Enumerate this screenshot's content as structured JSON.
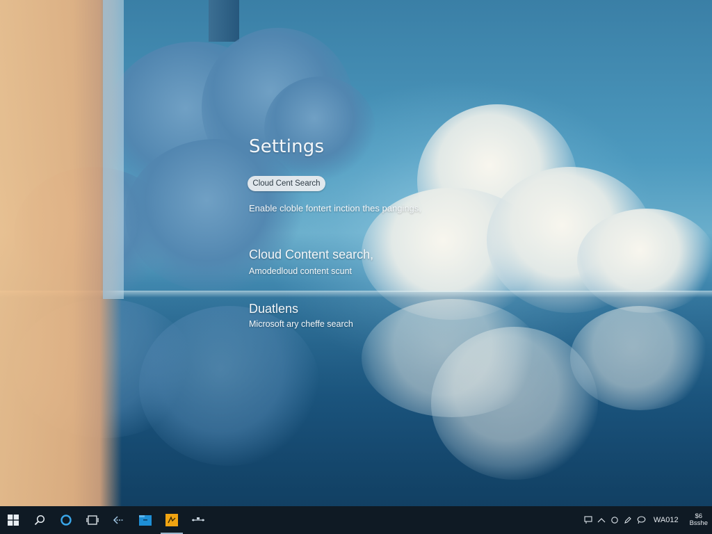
{
  "settings": {
    "title": "Settings",
    "pill_button_label": "Cloud Cent Search",
    "description": "Enable cloble fontert inction thes pangings,",
    "sections": [
      {
        "title": "Cloud Content search,",
        "subtitle": "Amodedloud content scunt"
      },
      {
        "title": "Duatlens",
        "subtitle": "Microsoft ary cheffe search"
      }
    ]
  },
  "taskbar": {
    "apps": [
      {
        "name": "start",
        "icon": "windows-logo-icon"
      },
      {
        "name": "search",
        "icon": "search-icon"
      },
      {
        "name": "cortana",
        "icon": "cortana-ring-icon"
      },
      {
        "name": "task-view",
        "icon": "task-view-icon"
      },
      {
        "name": "back",
        "icon": "back-arrow-icon"
      },
      {
        "name": "file-explorer",
        "icon": "folder-icon"
      },
      {
        "name": "app",
        "icon": "yellow-app-icon"
      },
      {
        "name": "network",
        "icon": "network-icon"
      }
    ],
    "tray": {
      "icons": [
        "chat-icon",
        "chevron-up-icon",
        "circle-icon",
        "pen-icon",
        "speech-icon"
      ],
      "clock_text": "WA012",
      "date_line1": "$6",
      "date_line2": "Bsshe"
    },
    "accent_colors": {
      "taskbar": "#0f1a24",
      "cortana": "#3aa6e8",
      "folder": "#1e8fd6",
      "app": "#f0a412"
    }
  }
}
